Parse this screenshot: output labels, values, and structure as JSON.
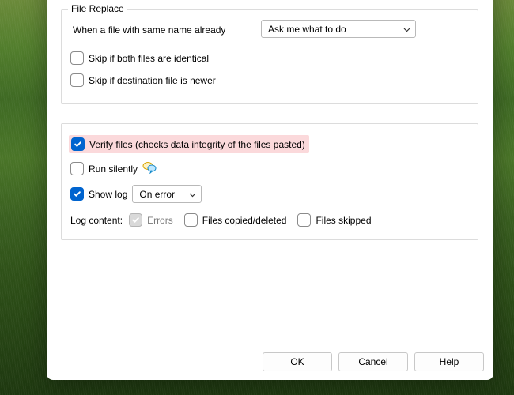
{
  "fileReplace": {
    "legend": "File Replace",
    "sameNameLabel": "When a file with same name already",
    "sameNameSelected": "Ask me what to do",
    "skipIdentical": "Skip if both files are identical",
    "skipDestNewer": "Skip if destination file is newer"
  },
  "options": {
    "verifyFiles": "Verify files (checks data integrity of the files pasted)",
    "runSilently": "Run silently",
    "showLog": "Show log",
    "showLogSelected": "On error",
    "logContentLabel": "Log content:",
    "errors": "Errors",
    "filesCopiedDeleted": "Files copied/deleted",
    "filesSkipped": "Files skipped"
  },
  "footer": {
    "ok": "OK",
    "cancel": "Cancel",
    "help": "Help"
  }
}
